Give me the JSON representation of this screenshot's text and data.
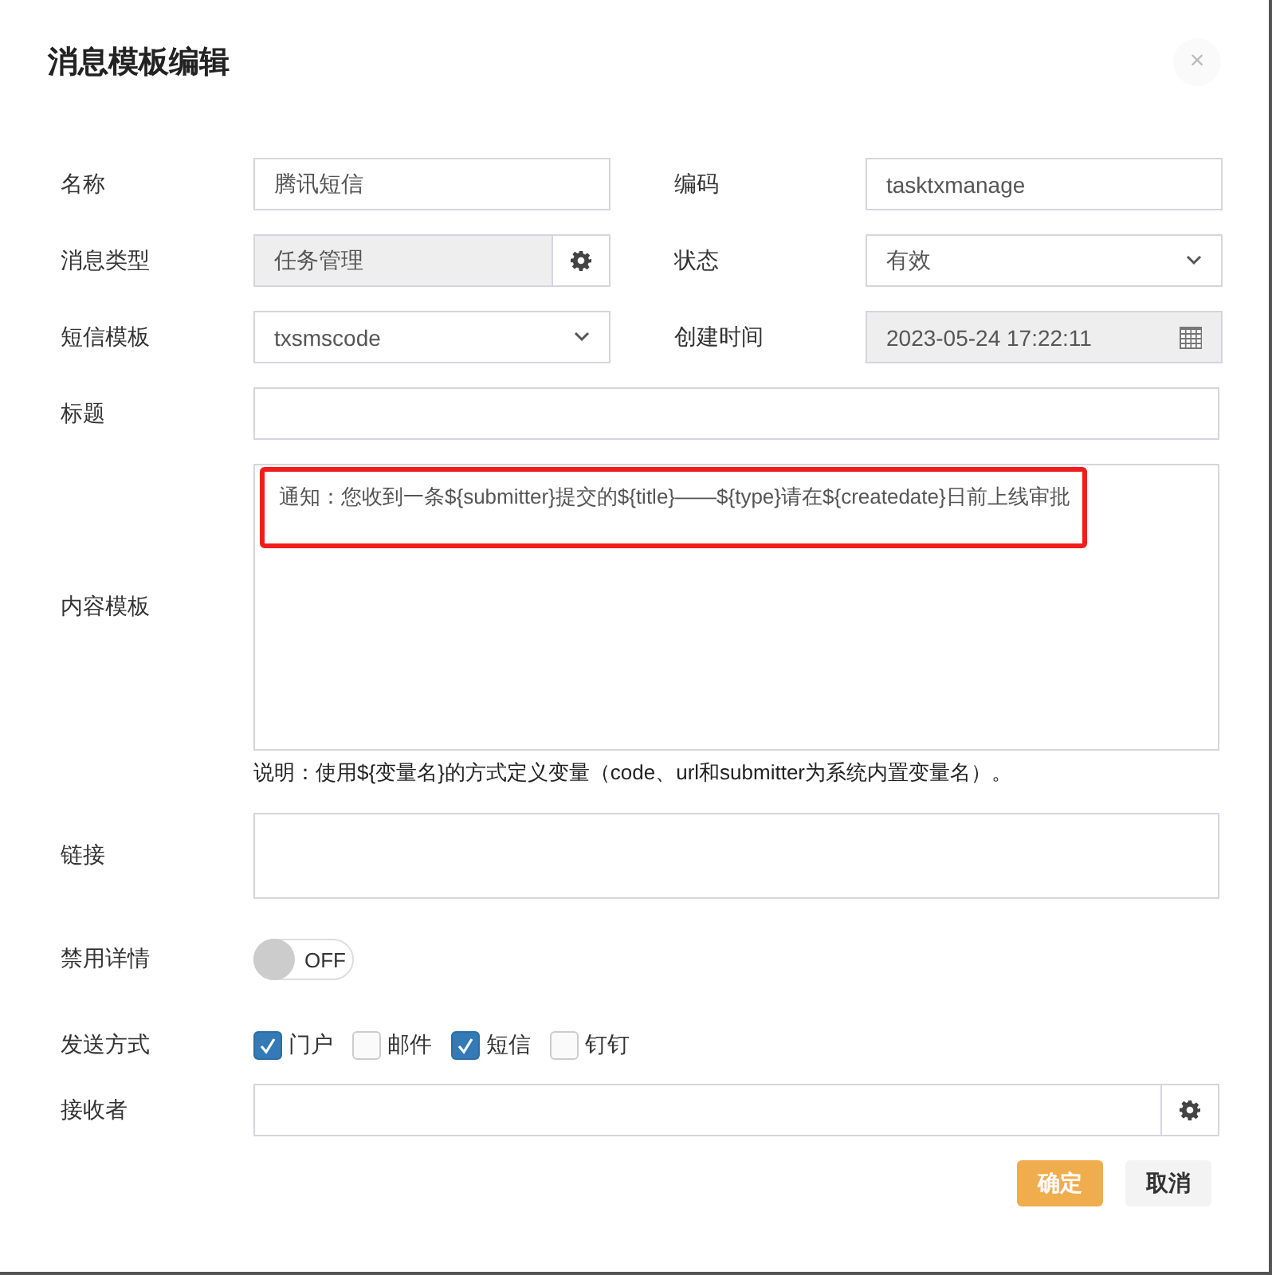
{
  "dialog": {
    "title": "消息模板编辑",
    "close": "×"
  },
  "name": {
    "label": "名称",
    "value": "腾讯短信"
  },
  "code": {
    "label": "编码",
    "value": "tasktxmanage"
  },
  "message_type": {
    "label": "消息类型",
    "value": "任务管理",
    "disabled": true
  },
  "status": {
    "label": "状态",
    "value": "有效"
  },
  "sms_template": {
    "label": "短信模板",
    "value": "txsmscode"
  },
  "created_time": {
    "label": "创建时间",
    "value": "2023-05-24 17:22:11",
    "disabled": true
  },
  "title_field": {
    "label": "标题"
  },
  "content": {
    "label": "内容模板",
    "value": "通知：您收到一条${submitter}提交的${title}——${type}请在${createdate}日前上线审批",
    "highlighted": true,
    "note": "说明：使用${变量名}的方式定义变量（code、url和submitter为系统内置变量名）。"
  },
  "link": {
    "label": "链接"
  },
  "disable_details": {
    "label": "禁用详情",
    "on": false,
    "text": "OFF"
  },
  "send_method": {
    "label": "发送方式",
    "options": [
      {
        "label": "门户",
        "checked": true
      },
      {
        "label": "邮件",
        "checked": false
      },
      {
        "label": "短信",
        "checked": true
      },
      {
        "label": "钉钉",
        "checked": false
      }
    ]
  },
  "receiver": {
    "label": "接收者"
  },
  "buttons": [
    {
      "label": "确定",
      "kind": "primary"
    },
    {
      "label": "取消",
      "kind": "default"
    }
  ]
}
